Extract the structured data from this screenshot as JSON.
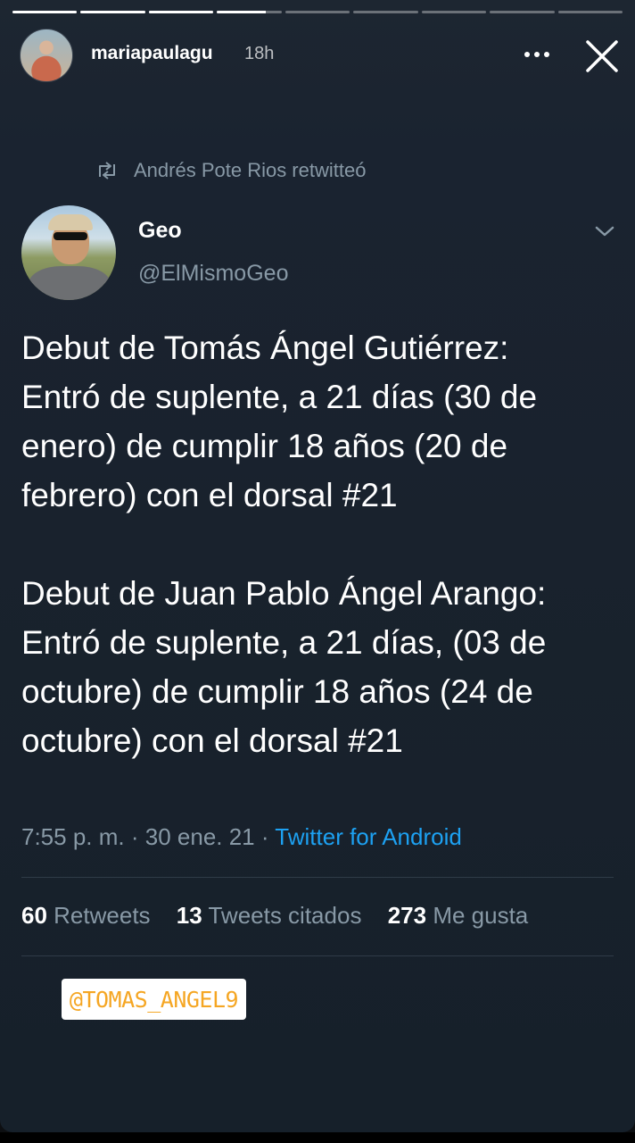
{
  "story": {
    "username": "mariapaulagu",
    "time": "18h",
    "progress_segments": [
      1,
      1,
      1,
      0.75,
      0,
      0,
      0,
      0,
      0
    ]
  },
  "tweet": {
    "retweeted_by": "Andrés Pote Rios retwitteó",
    "author_name": "Geo",
    "author_handle": "@ElMismoGeo",
    "paragraphs": [
      "Debut de Tomás Ángel Gutiérrez:",
      "Entró de suplente, a 21 días (30 de enero) de cumplir 18 años (20 de febrero) con el dorsal #21",
      "Debut de Juan Pablo Ángel Arango:",
      "Entró de suplente, a 21 días, (03 de octubre) de cumplir 18 años (24 de octubre) con el dorsal #21"
    ],
    "time": "7:55 p. m.",
    "date": "30 ene. 21",
    "source": "Twitter for Android",
    "retweets_count": "60",
    "retweets_label": "Retweets",
    "quotes_count": "13",
    "quotes_label": "Tweets citados",
    "likes_count": "273",
    "likes_label": "Me gusta"
  },
  "sticker": {
    "mention": "@TOMAS_ANGEL9"
  },
  "colors": {
    "link": "#1da1f2",
    "muted": "#8899a6",
    "mention_text": "#f5a623"
  },
  "icons": [
    "more-icon",
    "close-icon",
    "retweet-icon",
    "chevron-down-icon"
  ]
}
